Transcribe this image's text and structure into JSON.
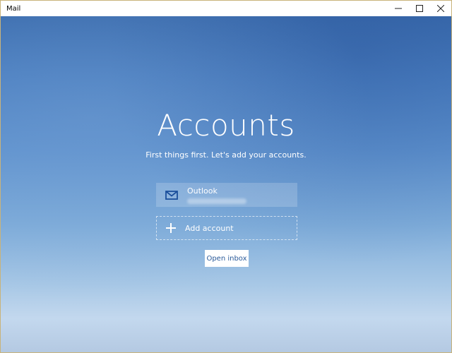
{
  "window": {
    "title": "Mail",
    "controls": {
      "minimize": "—",
      "maximize": "☐",
      "close": "✕"
    }
  },
  "main": {
    "heading": "Accounts",
    "subheading": "First things first. Let's add your accounts.",
    "account": {
      "name": "Outlook",
      "icon": "mail-envelope-icon"
    },
    "add_account": {
      "label": "Add account",
      "icon": "plus-icon"
    },
    "open_inbox_label": "Open inbox"
  },
  "colors": {
    "accent_icon": "#1b4f9c",
    "button_text": "#2a5a9a"
  }
}
